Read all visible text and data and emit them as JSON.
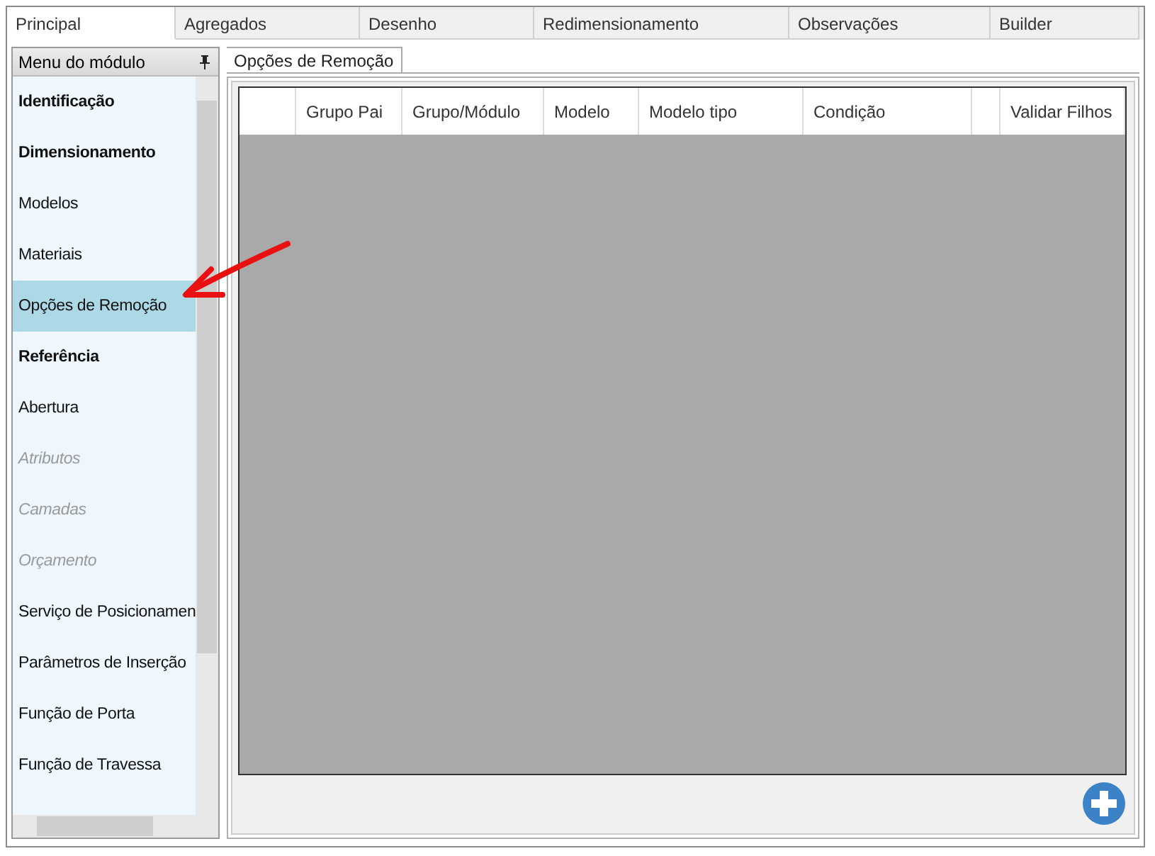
{
  "tabs": [
    {
      "label": "Principal",
      "selected": true
    },
    {
      "label": "Agregados",
      "selected": false
    },
    {
      "label": "Desenho",
      "selected": false
    },
    {
      "label": "Redimensionamento",
      "selected": false
    },
    {
      "label": "Observações",
      "selected": false
    },
    {
      "label": "Builder",
      "selected": false
    }
  ],
  "sidebar": {
    "title": "Menu do módulo",
    "items": [
      {
        "label": "Identificação",
        "kind": "header",
        "selected": false
      },
      {
        "label": "Dimensionamento",
        "kind": "header",
        "selected": false
      },
      {
        "label": "Modelos",
        "kind": "item",
        "selected": false
      },
      {
        "label": "Materiais",
        "kind": "item",
        "selected": false
      },
      {
        "label": "Opções de Remoção",
        "kind": "item",
        "selected": true
      },
      {
        "label": "Referência",
        "kind": "header",
        "selected": false
      },
      {
        "label": "Abertura",
        "kind": "item",
        "selected": false
      },
      {
        "label": "Atributos",
        "kind": "disabled",
        "selected": false
      },
      {
        "label": "Camadas",
        "kind": "disabled",
        "selected": false
      },
      {
        "label": "Orçamento",
        "kind": "disabled",
        "selected": false
      },
      {
        "label": "Serviço de Posicionamen",
        "kind": "item",
        "selected": false
      },
      {
        "label": "Parâmetros de Inserção",
        "kind": "item",
        "selected": false
      },
      {
        "label": "Função de Porta",
        "kind": "item",
        "selected": false
      },
      {
        "label": "Função de Travessa",
        "kind": "item",
        "selected": false
      }
    ]
  },
  "content": {
    "tab": "Opções de Remoção",
    "table": {
      "columns": [
        "",
        "Grupo Pai",
        "Grupo/Módulo",
        "Modelo",
        "Modelo tipo",
        "Condição",
        "",
        "Validar Filhos"
      ]
    }
  }
}
